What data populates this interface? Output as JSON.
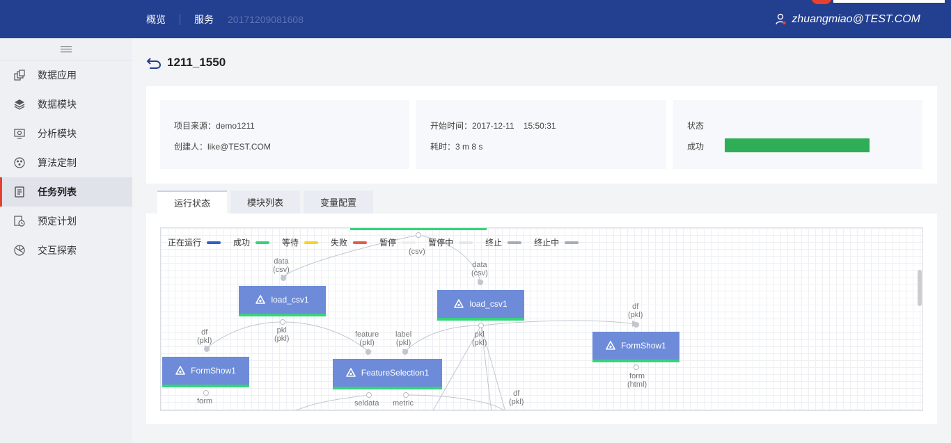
{
  "topbar": {
    "nav_overview": "概览",
    "nav_service": "服务",
    "crumb_id": "20171209081608",
    "user": "zhuangmiao@TEST.COM"
  },
  "sidebar": {
    "items": [
      {
        "label": "数据应用",
        "icon": "data-app-icon"
      },
      {
        "label": "数据模块",
        "icon": "layers-icon"
      },
      {
        "label": "分析模块",
        "icon": "analysis-icon"
      },
      {
        "label": "算法定制",
        "icon": "palette-icon"
      },
      {
        "label": "任务列表",
        "icon": "task-list-icon",
        "active": true
      },
      {
        "label": "预定计划",
        "icon": "schedule-icon"
      },
      {
        "label": "交互探索",
        "icon": "explore-icon"
      }
    ]
  },
  "page": {
    "title": "1211_1550"
  },
  "info": {
    "source": "项目来源：demo1211",
    "creator": "创建人：like@TEST.COM",
    "start_time": "开始时间：2017-12-11    15:50:31",
    "duration": "耗时：3 m 8 s",
    "status_label": "状态",
    "status_value": "成功",
    "status_color": "#2fae57",
    "status_progress": 1.0
  },
  "tabs": [
    {
      "label": "运行状态",
      "active": true
    },
    {
      "label": "模块列表"
    },
    {
      "label": "变量配置"
    }
  ],
  "legend": [
    {
      "label": "正在运行",
      "color": "#2f5fcf"
    },
    {
      "label": "成功",
      "color": "#35d37a"
    },
    {
      "label": "等待",
      "color": "#f5d328"
    },
    {
      "label": "失败",
      "color": "#e55a4a"
    },
    {
      "label": "暂停",
      "color": "#eeeeee"
    },
    {
      "label": "暂停中",
      "color": "#e4e6ea"
    },
    {
      "label": "终止",
      "color": "#a7acb8"
    },
    {
      "label": "终止中",
      "color": "#a7acb8"
    }
  ],
  "nodes": [
    {
      "label": "load_csv1"
    },
    {
      "label": "load_csv1"
    },
    {
      "label": "FormShow1"
    },
    {
      "label": "FeatureSelection1"
    },
    {
      "label": "FormShow1"
    }
  ],
  "ports": {
    "csv_top": "(csv)",
    "data": "data",
    "csv": "(csv)",
    "pkl": "pkl",
    "pkl_p": "(pkl)",
    "df": "df",
    "feature": "feature",
    "label": "label",
    "form": "form",
    "html": "(html)",
    "seldata": "seldata",
    "metric": "metric"
  }
}
